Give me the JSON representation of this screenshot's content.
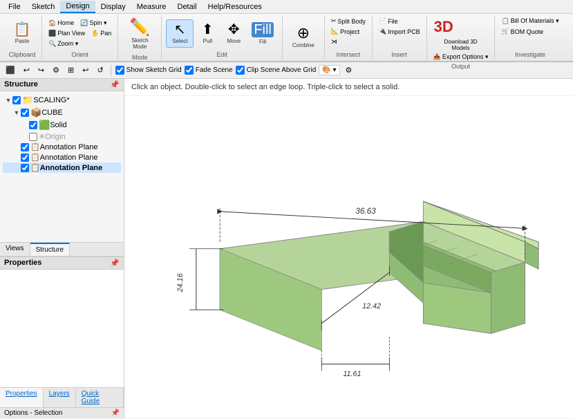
{
  "menu": {
    "items": [
      "File",
      "Sketch",
      "Design",
      "Display",
      "Measure",
      "Detail",
      "Help/Resources"
    ]
  },
  "ribbon": {
    "active_tab": "Design",
    "sections": {
      "clipboard": {
        "label": "Clipboard",
        "buttons": [
          {
            "id": "paste",
            "label": "Paste",
            "icon": "📋"
          }
        ]
      },
      "orient": {
        "label": "Orient",
        "buttons": [
          {
            "id": "home",
            "label": "Home",
            "icon": "🏠"
          },
          {
            "id": "plan_view",
            "label": "Plan View",
            "icon": "⬛"
          },
          {
            "id": "spin",
            "label": "Spin",
            "icon": "🔄"
          },
          {
            "id": "pan",
            "label": "Pan",
            "icon": "✋"
          },
          {
            "id": "zoom",
            "label": "Zoom ▾",
            "icon": "🔍"
          }
        ]
      },
      "mode": {
        "label": "Mode",
        "buttons": [
          {
            "id": "sketch_mode",
            "label": "Sketch Mode",
            "icon": "✏️"
          }
        ]
      },
      "select_group": {
        "label": "",
        "buttons": [
          {
            "id": "select",
            "label": "Select",
            "icon": "↖",
            "selected": true
          },
          {
            "id": "pull",
            "label": "Pull",
            "icon": "↑"
          },
          {
            "id": "move",
            "label": "Move",
            "icon": "✥"
          },
          {
            "id": "fill",
            "label": "Fill",
            "icon": "🪣"
          }
        ]
      },
      "edit": {
        "label": "Edit",
        "buttons": [
          {
            "id": "combine",
            "label": "Combine",
            "icon": "⊕"
          }
        ]
      },
      "intersect": {
        "label": "Intersect",
        "buttons": [
          {
            "id": "split_body",
            "label": "Split Body",
            "icon": "✂"
          },
          {
            "id": "project",
            "label": "Project",
            "icon": "📐"
          }
        ]
      },
      "insert": {
        "label": "Insert",
        "buttons": [
          {
            "id": "file",
            "label": "File",
            "icon": "📄"
          },
          {
            "id": "import_pcb",
            "label": "Import PCB",
            "icon": "🔌"
          }
        ]
      },
      "output": {
        "label": "Output",
        "buttons": [
          {
            "id": "download_3d",
            "label": "Download 3D Models",
            "icon": "⬇"
          },
          {
            "id": "export",
            "label": "Export Options ▾",
            "icon": "📤"
          }
        ]
      },
      "investigate": {
        "label": "Investigate",
        "buttons": [
          {
            "id": "bill_of_materials",
            "label": "Bill Of Materials ▾",
            "icon": "📋"
          },
          {
            "id": "bom_quote",
            "label": "BOM Quote",
            "icon": "🛒"
          }
        ]
      }
    }
  },
  "toolbar": {
    "undo_label": "Undo",
    "redo_label": "Redo",
    "checkboxes": [
      {
        "id": "show_sketch_grid",
        "label": "Show Sketch Grid",
        "checked": true
      },
      {
        "id": "fade_scene",
        "label": "Fade Scene",
        "checked": true
      },
      {
        "id": "clip_scene_above_grid",
        "label": "Clip Scene Above Grid",
        "checked": true
      }
    ]
  },
  "left_panel": {
    "structure_header": "Structure",
    "pin_icon": "📌",
    "tree": [
      {
        "id": "scaling",
        "label": "SCALING*",
        "depth": 0,
        "expand": "▼",
        "checked": true,
        "icon": "📁",
        "bold": false
      },
      {
        "id": "cube",
        "label": "CUBE",
        "depth": 1,
        "expand": "▼",
        "checked": true,
        "icon": "📦",
        "bold": false
      },
      {
        "id": "solid",
        "label": "Solid",
        "depth": 2,
        "expand": "",
        "checked": true,
        "icon": "🟩",
        "bold": false
      },
      {
        "id": "origin",
        "label": "Origin",
        "depth": 2,
        "expand": "",
        "checked": false,
        "icon": "✳",
        "bold": false
      },
      {
        "id": "annotation1",
        "label": "Annotation Plane",
        "depth": 1,
        "expand": "",
        "checked": true,
        "icon": "📋",
        "bold": false
      },
      {
        "id": "annotation2",
        "label": "Annotation Plane",
        "depth": 1,
        "expand": "",
        "checked": true,
        "icon": "📋",
        "bold": false
      },
      {
        "id": "annotation3",
        "label": "Annotation Plane",
        "depth": 1,
        "expand": "",
        "checked": true,
        "icon": "📋",
        "bold": true
      }
    ],
    "view_tabs": [
      "Views",
      "Structure"
    ],
    "active_view_tab": "Structure",
    "properties_header": "Properties",
    "bottom_tabs": [
      "Properties",
      "Layers",
      "Quick Guide"
    ],
    "options_label": "Options - Selection"
  },
  "viewport": {
    "hint": "Click an object. Double-click to select an edge loop. Triple-click to select a solid.",
    "model": {
      "dimensions": {
        "length": "36.63",
        "width1": "24.16",
        "width2": "12.42",
        "depth": "11.61"
      },
      "color": "#8fbc74",
      "color_light": "#b5d49a",
      "color_dark": "#6a9954"
    }
  }
}
